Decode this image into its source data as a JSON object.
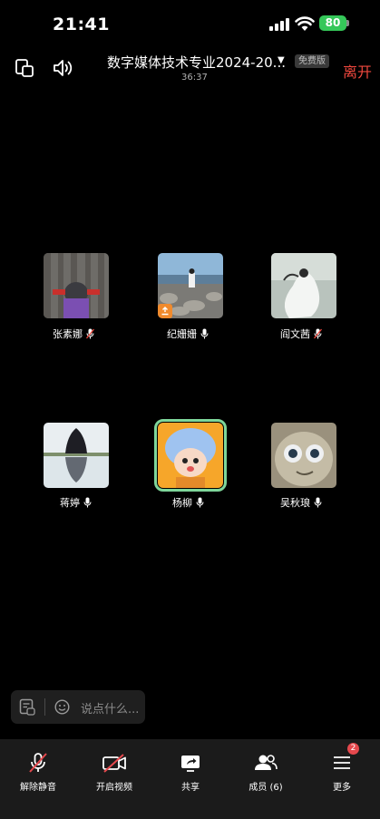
{
  "status_bar": {
    "time": "21:41",
    "battery": "80"
  },
  "header": {
    "title": "数字媒体技术专业2024-20...",
    "badge": "免费版",
    "leave": "离开",
    "duration": "36:37"
  },
  "participants": [
    {
      "name": "张素娜",
      "mic": "muted"
    },
    {
      "name": "纪姗姗",
      "mic": "on"
    },
    {
      "name": "阎文茜",
      "mic": "muted"
    },
    {
      "name": "蒋婷",
      "mic": "on"
    },
    {
      "name": "杨柳",
      "mic": "on"
    },
    {
      "name": "吴秋琅",
      "mic": "on"
    }
  ],
  "chat": {
    "placeholder": "说点什么..."
  },
  "toolbar": {
    "unmute": "解除静音",
    "video": "开启视频",
    "share": "共享",
    "members": "成员 (6)",
    "more": "更多",
    "more_badge": "2"
  },
  "colors": {
    "leave": "#f0483e",
    "active_speaker": "#7ed69b",
    "battery": "#35c759",
    "badge": "#e5484d"
  }
}
